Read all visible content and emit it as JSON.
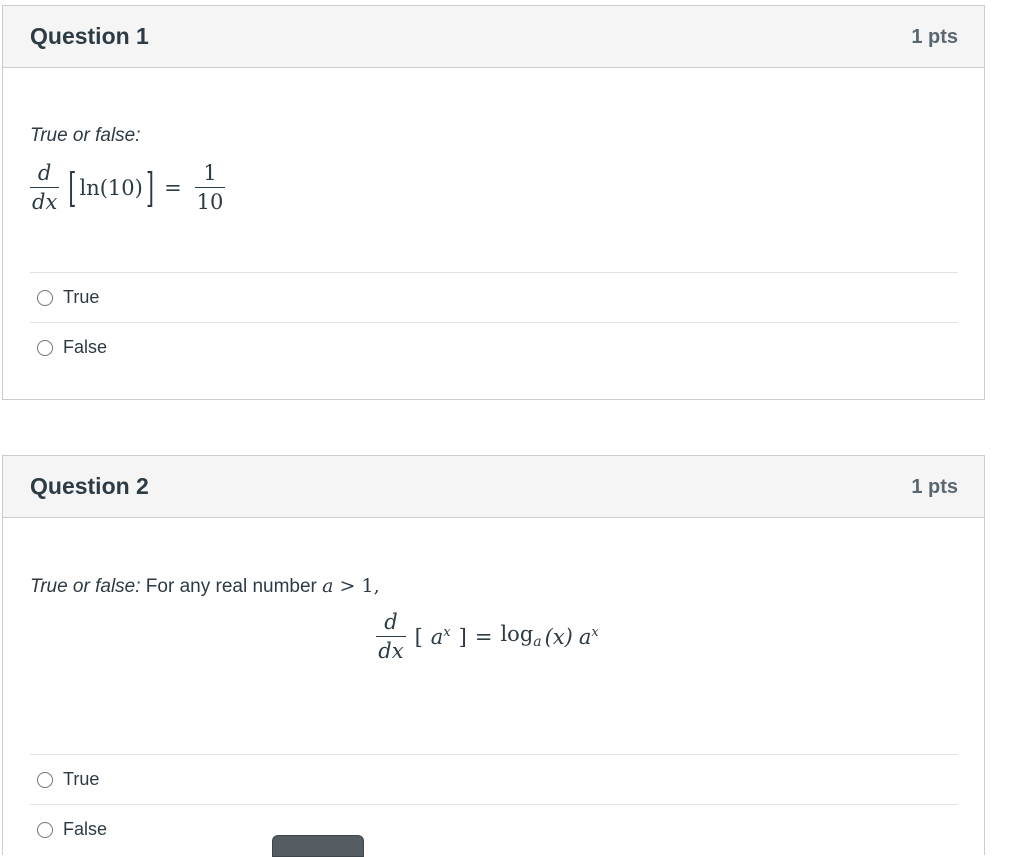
{
  "questions": [
    {
      "title": "Question 1",
      "points": "1 pts",
      "prompt_italic": "True or false:",
      "prompt_rest": "",
      "equation": {
        "frac_num": "d",
        "frac_den": "dx",
        "inner": "ln(10)",
        "equals": "=",
        "rhs_num": "1",
        "rhs_den": "10"
      },
      "answers": [
        "True",
        "False"
      ]
    },
    {
      "title": "Question 2",
      "points": "1 pts",
      "prompt_italic": "True or false:",
      "prompt_rest": " For any real number ",
      "prompt_math_var": "a",
      "prompt_math_rel": " > 1,",
      "equation": {
        "frac_num": "d",
        "frac_den": "dx",
        "inner_base": "a",
        "inner_exp": "x",
        "equals": "=",
        "log": "log",
        "log_sub": "a",
        "log_arg": "(x)",
        "rhs_base": "a",
        "rhs_exp": "x"
      },
      "answers": [
        "True",
        "False"
      ]
    }
  ]
}
